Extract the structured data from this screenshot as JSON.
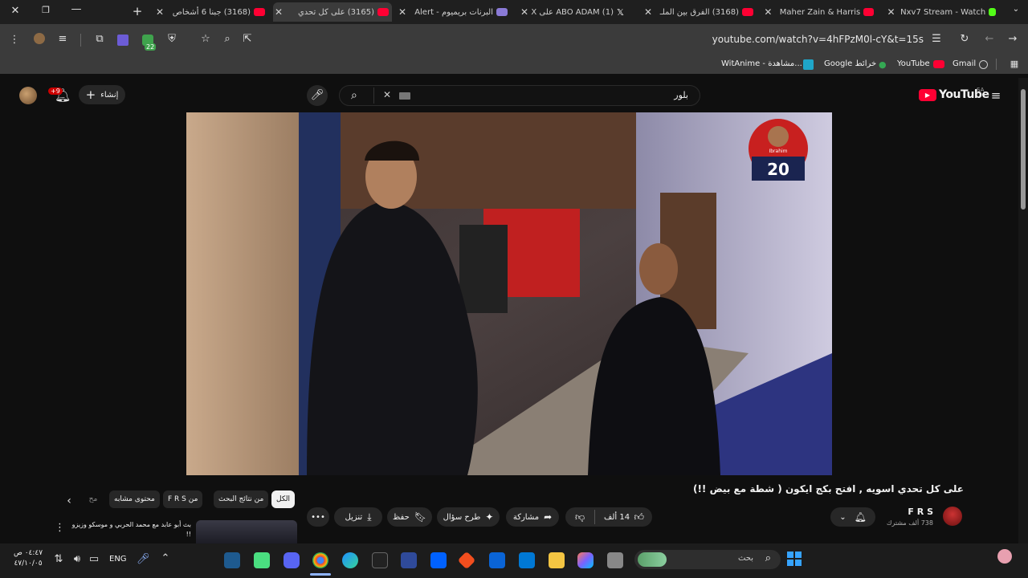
{
  "tabs": [
    {
      "title": "(3168) جبنا 6 أشخاص"
    },
    {
      "title": "(3165) على كل تحدي"
    },
    {
      "title": "البرنات بريميوم - Alert"
    },
    {
      "title": "(1) ABO ADAM على X"
    },
    {
      "title": "(3168) الفرق بين الملـ"
    },
    {
      "title": "Maher Zain & Harris"
    },
    {
      "title": "Nxv7 Stream - Watch"
    }
  ],
  "browser": {
    "url": "youtube.com/watch?v=4hFPzM0l-cY&t=15s",
    "extension_badge": "22"
  },
  "bookmarks": [
    "Gmail",
    "YouTube",
    "خرائط Google",
    "WitAnime - مشاهدة..."
  ],
  "youtube": {
    "logo": "YouTube",
    "region": "SA",
    "search_value": "بلور",
    "create_label": "إنشاء",
    "notif_badge": "+9",
    "video_title": "على كل تحدي اسويه , افتح بكج ايكون ( شطة مع بيض !!)",
    "channel": {
      "name": "F R S",
      "subscribers": "738 ألف مشترك"
    },
    "actions": {
      "likes": "14 ألف",
      "share": "مشاركة",
      "ask": "طرح سؤال",
      "save": "حفظ",
      "download": "تنزيل"
    },
    "chips": [
      "الكل",
      "من نتائج البحث",
      "من F R S",
      "محتوى مشابه",
      "مح"
    ],
    "related": {
      "title": "بث أبو عابد مع محمد الحربي و موسكو وزيزو !!"
    },
    "overlay_number": "20",
    "overlay_name": "Ibrahim"
  },
  "taskbar": {
    "search_placeholder": "بحث",
    "language": "ENG",
    "time": "٠٤:٤٧ ص",
    "date": "٤٧/١٠/٠٥"
  },
  "colors": {
    "youtube_red": "#ff0033",
    "background": "#0f0f0f",
    "chip_active": "#f1f1f1"
  }
}
